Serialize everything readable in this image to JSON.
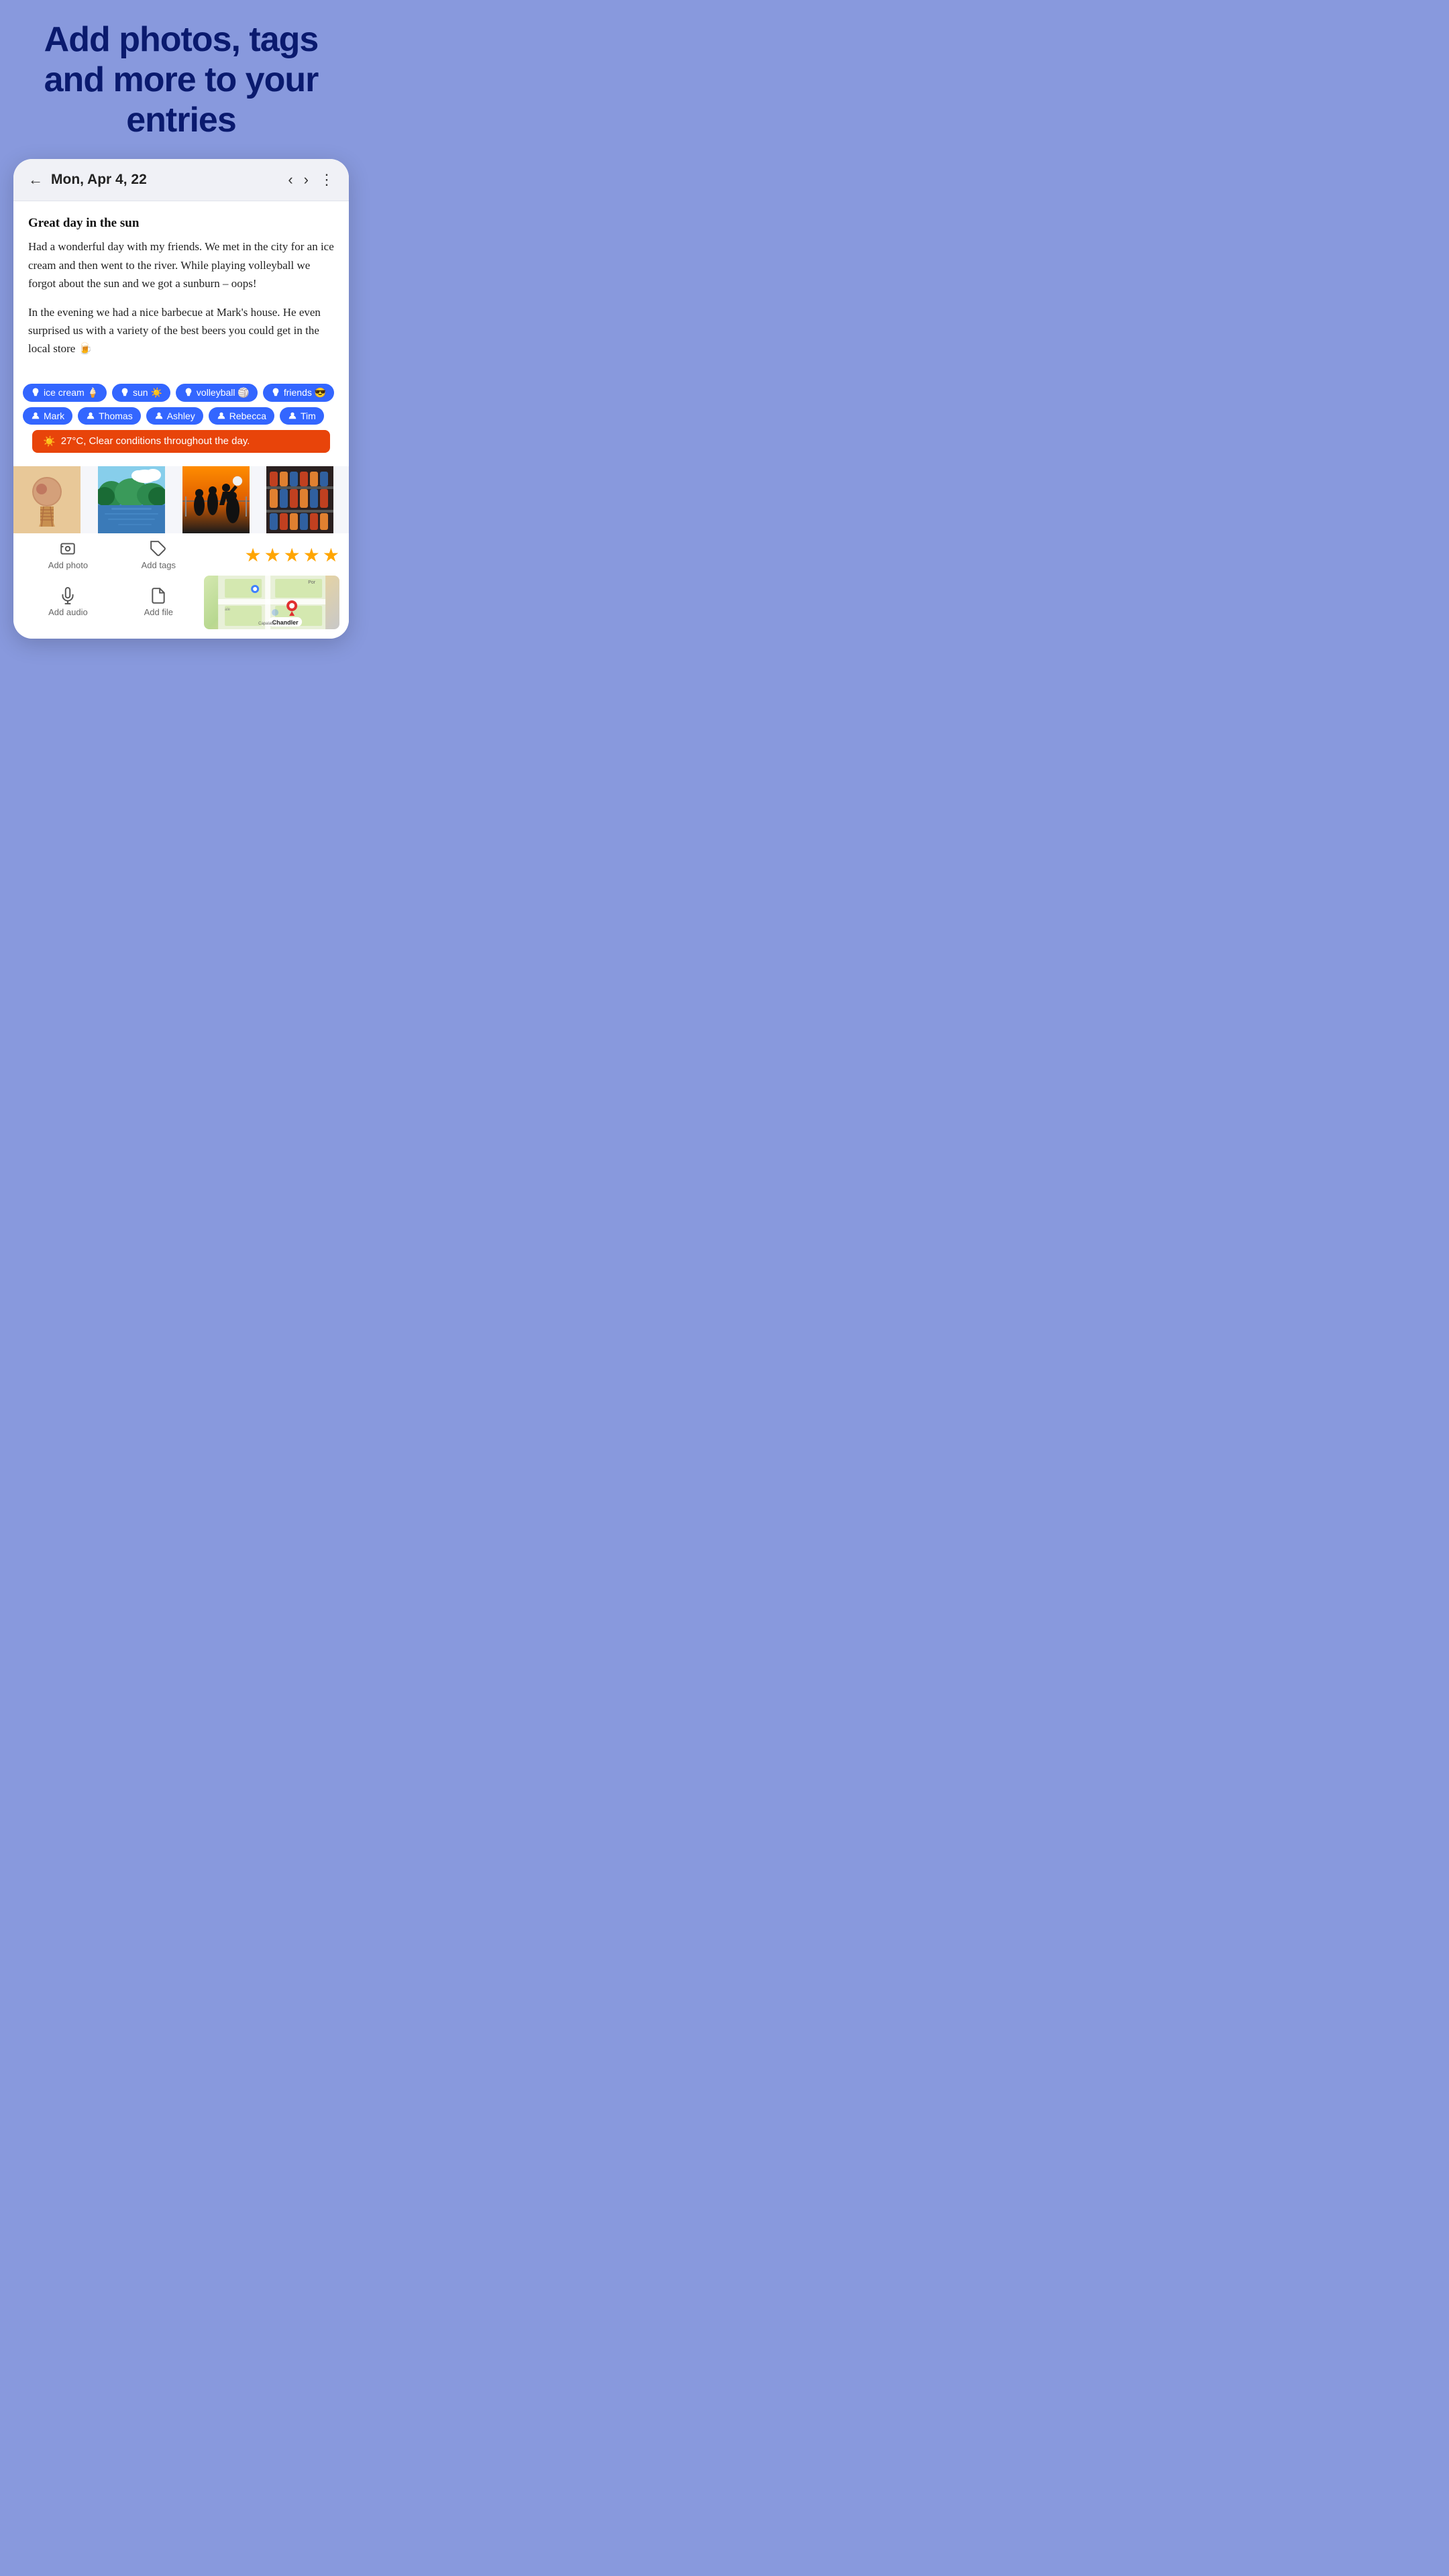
{
  "hero": {
    "title": "Add photos, tags and more to your entries"
  },
  "header": {
    "date": "Mon, Apr 4, 22",
    "back_label": "back",
    "prev_label": "previous",
    "next_label": "next",
    "menu_label": "more options"
  },
  "entry": {
    "title": "Great day in the sun",
    "paragraph1": "Had a wonderful day with my friends. We met in the city for an ice cream and then went to the river. While playing volleyball we forgot about the sun and we got a sunburn – oops!",
    "paragraph2": "In the evening we had a nice barbecue at Mark's house. He even surprised us with a variety of the best beers you could get in the local store 🍺"
  },
  "tags": [
    {
      "icon": "tag",
      "label": "ice cream 🍦"
    },
    {
      "icon": "tag",
      "label": "sun ☀️"
    },
    {
      "icon": "tag",
      "label": "volleyball 🏐"
    },
    {
      "icon": "tag",
      "label": "friends 😎"
    },
    {
      "icon": "tag",
      "label": "Mark"
    },
    {
      "icon": "person",
      "label": "Thomas"
    },
    {
      "icon": "person",
      "label": "Ashley"
    },
    {
      "icon": "person",
      "label": "Rebecca"
    },
    {
      "icon": "person",
      "label": "Tim"
    }
  ],
  "weather": {
    "text": "27°C, Clear conditions throughout the day.",
    "icon": "☀️"
  },
  "photos": [
    {
      "type": "icecream",
      "alt": "Ice cream cone"
    },
    {
      "type": "river",
      "alt": "River with trees"
    },
    {
      "type": "volleyball",
      "alt": "Volleyball silhouette"
    },
    {
      "type": "beer",
      "alt": "Beer cans on shelves"
    }
  ],
  "toolbar": {
    "add_photo_label": "Add photo",
    "add_tags_label": "Add tags",
    "add_audio_label": "Add audio",
    "add_file_label": "Add file",
    "stars": 5,
    "map_label": "Chandler"
  },
  "colors": {
    "tag_bg": "#3366ff",
    "weather_bg": "#e8440a",
    "accent": "#3366ff"
  }
}
